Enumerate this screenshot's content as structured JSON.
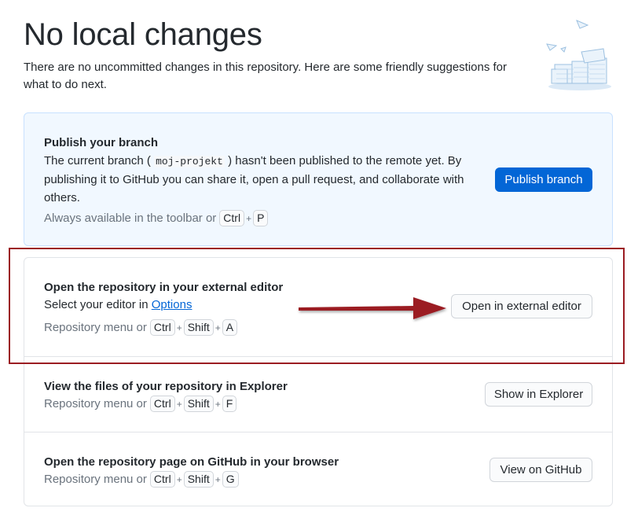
{
  "header": {
    "title": "No local changes",
    "subtitle": "There are no uncommitted changes in this repository. Here are some friendly suggestions for what to do next."
  },
  "publish": {
    "title": "Publish your branch",
    "desc_before": "The current branch (",
    "branch": "moj-projekt",
    "desc_after": ") hasn't been published to the remote yet. By publishing it to GitHub you can share it, open a pull request, and collaborate with others.",
    "hint": "Always available in the toolbar or",
    "keys": [
      "Ctrl",
      "P"
    ],
    "button": "Publish branch"
  },
  "actions": [
    {
      "title": "Open the repository in your external editor",
      "desc": "Select your editor in",
      "link": "Options",
      "hint": "Repository menu or",
      "keys": [
        "Ctrl",
        "Shift",
        "A"
      ],
      "button": "Open in external editor"
    },
    {
      "title": "View the files of your repository in Explorer",
      "hint": "Repository menu or",
      "keys": [
        "Ctrl",
        "Shift",
        "F"
      ],
      "button": "Show in Explorer"
    },
    {
      "title": "Open the repository page on GitHub in your browser",
      "hint": "Repository menu or",
      "keys": [
        "Ctrl",
        "Shift",
        "G"
      ],
      "button": "View on GitHub"
    }
  ],
  "annotation": {
    "highlight_color": "#9b1c22",
    "arrow_color": "#9b1c22"
  },
  "colors": {
    "primary_button": "#0366d6",
    "link": "#0366d6",
    "publish_background": "#f1f8ff"
  },
  "icons": {
    "illustration": "paper-stack-illustration",
    "arrow": "right-arrow"
  },
  "plus_sign": "+"
}
